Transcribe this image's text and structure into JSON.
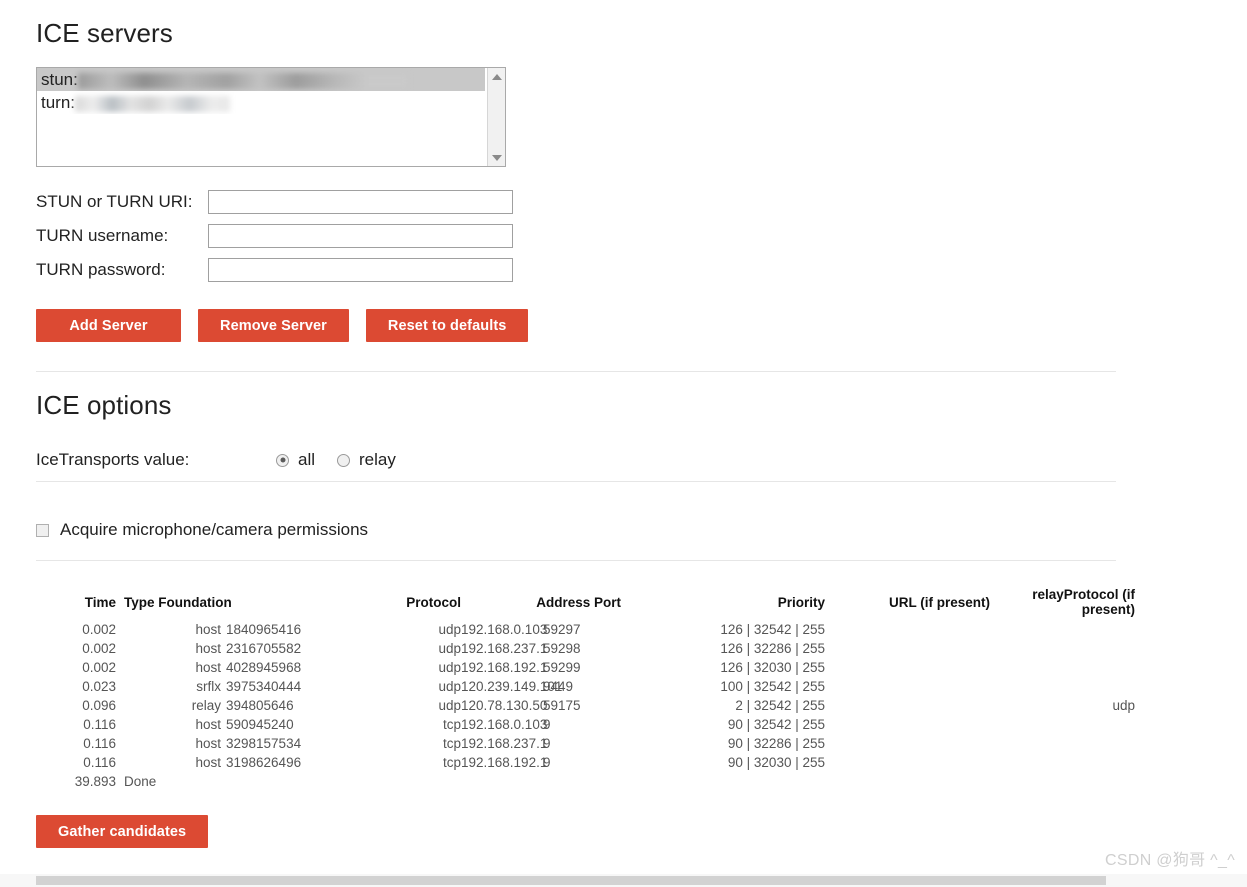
{
  "ice_servers": {
    "title": "ICE servers",
    "listbox": {
      "options": [
        {
          "prefix": "stun:",
          "redacted": true,
          "selected": true
        },
        {
          "prefix": "turn:",
          "redacted": true,
          "selected": false
        }
      ]
    },
    "fields": [
      {
        "label": "STUN or TURN URI:",
        "value": "",
        "placeholder": ""
      },
      {
        "label": "TURN username:",
        "value": "",
        "placeholder": ""
      },
      {
        "label": "TURN password:",
        "value": "",
        "placeholder": ""
      }
    ],
    "buttons": {
      "add": "Add Server",
      "remove": "Remove Server",
      "reset": "Reset to defaults"
    }
  },
  "ice_options": {
    "title": "ICE options",
    "transports_label": "IceTransports value:",
    "transports": [
      {
        "label": "all",
        "checked": true
      },
      {
        "label": "relay",
        "checked": false
      }
    ],
    "permissions": {
      "label": "Acquire microphone/camera permissions",
      "checked": false
    }
  },
  "candidates_table": {
    "headers": {
      "time": "Time",
      "type_foundation": "Type Foundation",
      "protocol": "Protocol",
      "address_port": "Address Port",
      "priority": "Priority",
      "url": "URL (if present)",
      "relay_protocol": "relayProtocol (if present)"
    },
    "rows": [
      {
        "time": "0.002",
        "type": "host",
        "foundation": "1840965416",
        "protocol": "udp",
        "address": "192.168.0.103",
        "port": "59297",
        "priority": "126 | 32542 | 255",
        "url": "",
        "relay_protocol": ""
      },
      {
        "time": "0.002",
        "type": "host",
        "foundation": "2316705582",
        "protocol": "udp",
        "address": "192.168.237.1",
        "port": "59298",
        "priority": "126 | 32286 | 255",
        "url": "",
        "relay_protocol": ""
      },
      {
        "time": "0.002",
        "type": "host",
        "foundation": "4028945968",
        "protocol": "udp",
        "address": "192.168.192.1",
        "port": "59299",
        "priority": "126 | 32030 | 255",
        "url": "",
        "relay_protocol": ""
      },
      {
        "time": "0.023",
        "type": "srflx",
        "foundation": "3975340444",
        "protocol": "udp",
        "address": "120.239.149.101",
        "port": "9449",
        "priority": "100 | 32542 | 255",
        "url": "",
        "relay_protocol": ""
      },
      {
        "time": "0.096",
        "type": "relay",
        "foundation": "394805646",
        "protocol": "udp",
        "address": "120.78.130.50",
        "port": "59175",
        "priority": "2 | 32542 | 255",
        "url": "",
        "relay_protocol": "udp"
      },
      {
        "time": "0.116",
        "type": "host",
        "foundation": "590945240",
        "protocol": "tcp",
        "address": "192.168.0.103",
        "port": "9",
        "priority": "90 | 32542 | 255",
        "url": "",
        "relay_protocol": ""
      },
      {
        "time": "0.116",
        "type": "host",
        "foundation": "3298157534",
        "protocol": "tcp",
        "address": "192.168.237.1",
        "port": "9",
        "priority": "90 | 32286 | 255",
        "url": "",
        "relay_protocol": ""
      },
      {
        "time": "0.116",
        "type": "host",
        "foundation": "3198626496",
        "protocol": "tcp",
        "address": "192.168.192.1",
        "port": "9",
        "priority": "90 | 32030 | 255",
        "url": "",
        "relay_protocol": ""
      }
    ],
    "final_row": {
      "time": "39.893",
      "label": "Done"
    }
  },
  "footer": {
    "gather_button": "Gather candidates",
    "watermark": "CSDN @狗哥  ^_^"
  },
  "colors": {
    "button_red": "#dc4a33",
    "text": "#212121",
    "divider": "#e6e6e6",
    "selected_option": "#c8c8c8"
  }
}
